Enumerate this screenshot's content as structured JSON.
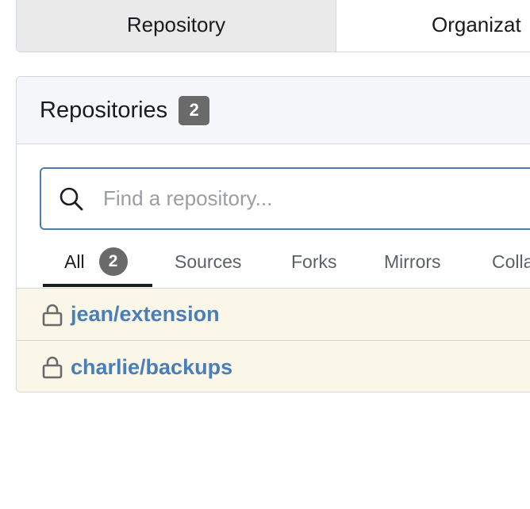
{
  "top_menu": {
    "items": [
      {
        "label": "Repository",
        "active": true
      },
      {
        "label": "Organizat",
        "active": false
      }
    ]
  },
  "repositories": {
    "title": "Repositories",
    "count": "2"
  },
  "search": {
    "placeholder": "Find a repository...",
    "value": "",
    "icon": "search-icon"
  },
  "tabs": [
    {
      "label": "All",
      "badge": "2",
      "active": true
    },
    {
      "label": "Sources"
    },
    {
      "label": "Forks"
    },
    {
      "label": "Mirrors"
    },
    {
      "label": "Colla"
    }
  ],
  "repo_list": [
    {
      "name": "jean/extension",
      "icon": "lock-icon"
    },
    {
      "name": "charlie/backups",
      "icon": "lock-icon"
    }
  ],
  "colors": {
    "accent": "#4f7cac",
    "link": "#4a7eb8",
    "badge": "#6a6a6a",
    "row_highlight": "#faf7e8"
  }
}
